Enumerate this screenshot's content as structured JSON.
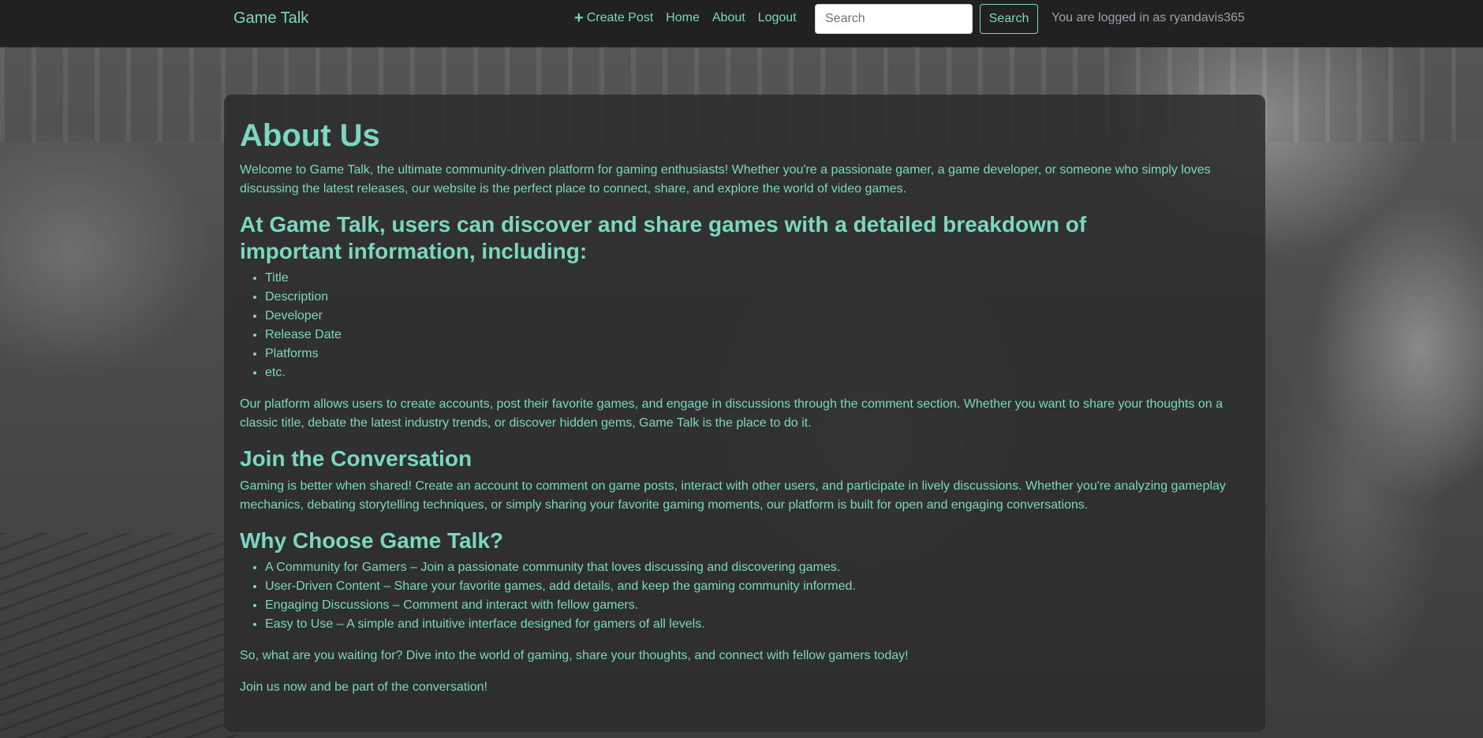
{
  "navbar": {
    "brand": "Game Talk",
    "links": [
      {
        "label": "Create Post",
        "icon": "plus-icon"
      },
      {
        "label": "Home"
      },
      {
        "label": "About"
      },
      {
        "label": "Logout"
      }
    ],
    "search": {
      "placeholder": "Search",
      "value": ""
    },
    "search_button": "Search",
    "login_status": "You are logged in as ryandavis365"
  },
  "about": {
    "title": "About Us",
    "intro": "Welcome to Game Talk, the ultimate community-driven platform for gaming enthusiasts! Whether you're a passionate gamer, a game developer, or someone who simply loves discussing the latest releases, our website is the perfect place to connect, share, and explore the world of video games.",
    "features_heading": "At Game Talk, users can discover and share games with a detailed breakdown of important information, including:",
    "features": [
      "Title",
      "Description",
      "Developer",
      "Release Date",
      "Platforms",
      "etc."
    ],
    "platform_text": "Our platform allows users to create accounts, post their favorite games, and engage in discussions through the comment section. Whether you want to share your thoughts on a classic title, debate the latest industry trends, or discover hidden gems, Game Talk is the place to do it.",
    "join_heading": "Join the Conversation",
    "join_text": "Gaming is better when shared! Create an account to comment on game posts, interact with other users, and participate in lively discussions. Whether you're analyzing gameplay mechanics, debating storytelling techniques, or simply sharing your favorite gaming moments, our platform is built for open and engaging conversations.",
    "why_heading": "Why Choose Game Talk?",
    "why_items": [
      "A Community for Gamers – Join a passionate community that loves discussing and discovering games.",
      "User-Driven Content – Share your favorite games, add details, and keep the gaming community informed.",
      "Engaging Discussions – Comment and interact with fellow gamers.",
      "Easy to Use – A simple and intuitive interface designed for gamers of all levels."
    ],
    "cta_text": "So, what are you waiting for? Dive into the world of gaming, share your thoughts, and connect with fellow gamers today!",
    "closing_text": "Join us now and be part of the conversation!"
  },
  "colors": {
    "accent": "#7ad8c0",
    "navbar_bg": "#212121",
    "panel_bg": "#2c2c2c",
    "muted_text": "#9aa3ab"
  }
}
